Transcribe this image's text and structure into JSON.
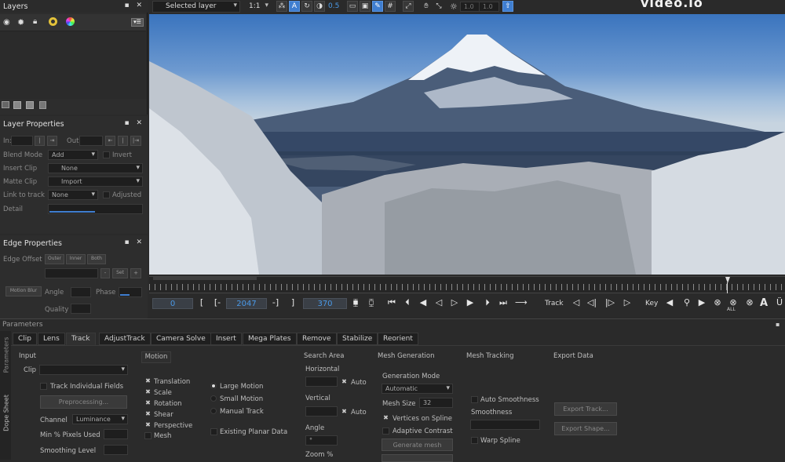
{
  "layers": {
    "title": "Layers",
    "ctl": "▪ ✕"
  },
  "layer_props": {
    "title": "Layer Properties",
    "ctl": "▪ ✕",
    "in_label": "In:",
    "out_label": "Out",
    "blend_label": "Blend Mode",
    "blend_value": "Add",
    "invert_label": "Invert",
    "insert_label": "Insert Clip",
    "insert_value": "None",
    "matte_label": "Matte Clip",
    "matte_value": "Import",
    "link_label": "Link to track",
    "link_value": "None",
    "adjusted_label": "Adjusted",
    "detail_label": "Detail"
  },
  "edge_props": {
    "title": "Edge Properties",
    "ctl": "▪ ✕",
    "offset_label": "Edge Offset",
    "btn1": "Outer",
    "btn2": "Inner",
    "btn3": "Both",
    "btn4": "Set",
    "motion_blur": "Motion Blur",
    "angle_label": "Angle",
    "phase_label": "Phase",
    "quality_label": "Quality"
  },
  "toolbar": {
    "view_select": "Selected layer",
    "zoom_select": "1:1",
    "opacity": "0.5",
    "val1": "1.0",
    "val2": "1.0"
  },
  "viewer": {
    "watermark": "video.io"
  },
  "timeline": {
    "current": "0",
    "in_frame": "2047",
    "out_frame": "370",
    "track_label": "Track",
    "key_label": "Key",
    "all_label": "ALL"
  },
  "params": {
    "title": "Parameters",
    "side1": "Parameters",
    "side2": "Dope Sheet",
    "tabs": [
      {
        "label": "Clip"
      },
      {
        "label": "Lens"
      },
      {
        "label": "Track"
      },
      {
        "label": "AdjustTrack"
      },
      {
        "label": "Camera Solve"
      },
      {
        "label": "Insert"
      },
      {
        "label": "Mega Plates"
      },
      {
        "label": "Remove"
      },
      {
        "label": "Stabilize"
      },
      {
        "label": "Reorient"
      }
    ],
    "input": {
      "header": "Input",
      "clip_label": "Clip",
      "track_individual": "Track Individual Fields",
      "preprocessing": "Preprocessing...",
      "channel_label": "Channel",
      "channel_value": "Luminance",
      "min_pixels": "Min % Pixels Used",
      "smoothing": "Smoothing Level"
    },
    "motion": {
      "header": "Motion",
      "items": [
        "Translation",
        "Scale",
        "Rotation",
        "Shear",
        "Perspective",
        "Mesh"
      ],
      "large": "Large Motion",
      "small": "Small Motion",
      "manual": "Manual Track",
      "existing": "Existing Planar Data"
    },
    "search": {
      "header": "Search Area",
      "horizontal": "Horizontal",
      "auto1": "Auto",
      "vertical": "Vertical",
      "auto2": "Auto",
      "angle": "Angle",
      "zoom": "Zoom %"
    },
    "mesh": {
      "header": "Mesh Generation",
      "mode_label": "Generation Mode",
      "mode_value": "Automatic",
      "size_label": "Mesh Size",
      "size_value": "32",
      "vertices": "Vertices on Spline",
      "adaptive": "Adaptive Contrast",
      "generate": "Generate mesh"
    },
    "tracking": {
      "header": "Mesh Tracking",
      "auto_smooth": "Auto Smoothness",
      "smoothness": "Smoothness",
      "warp": "Warp Spline"
    },
    "export": {
      "header": "Export Data",
      "export_track": "Export Track...",
      "export_shape": "Export Shape..."
    }
  }
}
